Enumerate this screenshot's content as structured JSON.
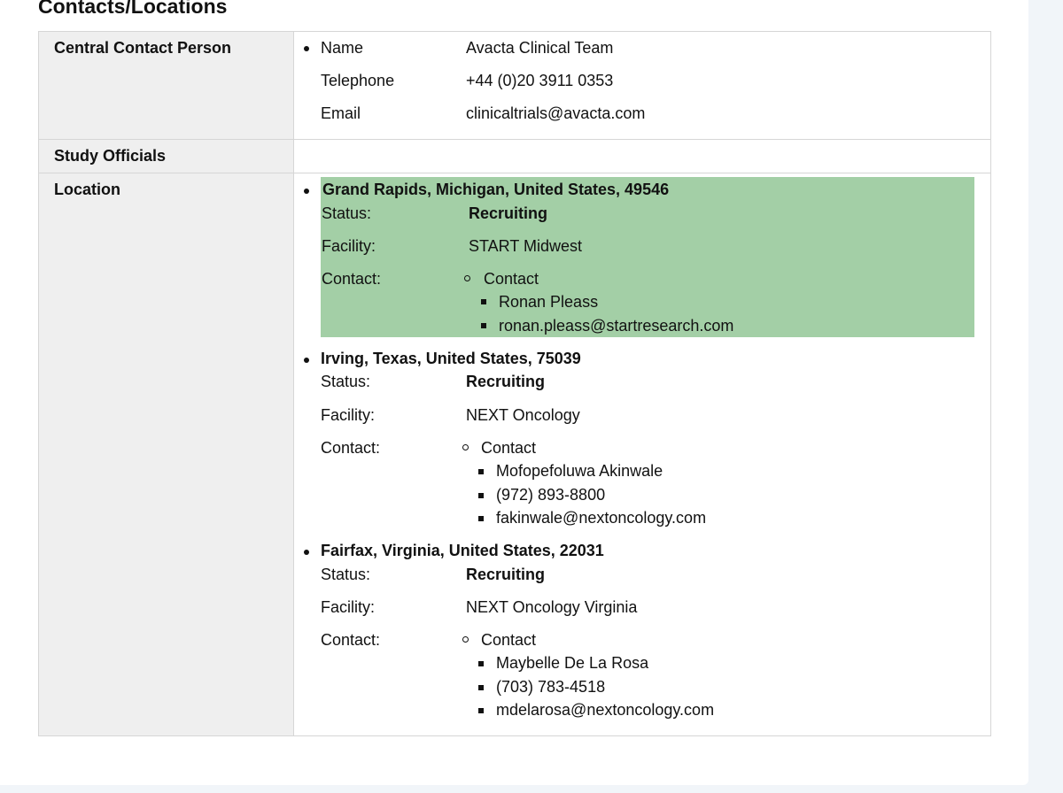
{
  "section_title": "Contacts/Locations",
  "central_contact": {
    "label": "Central Contact Person",
    "fields": [
      {
        "key": "Name",
        "value": "Avacta Clinical Team"
      },
      {
        "key": "Telephone",
        "value": "+44 (0)20 3911 0353"
      },
      {
        "key": "Email",
        "value": "clinicaltrials@avacta.com"
      }
    ]
  },
  "study_officials": {
    "label": "Study Officials"
  },
  "location": {
    "label": "Location",
    "status_key": "Status:",
    "facility_key": "Facility:",
    "contact_key": "Contact:",
    "contact_header": "Contact",
    "sites": [
      {
        "place": "Grand Rapids, Michigan, United States, 49546",
        "status": "Recruiting",
        "facility": "START Midwest",
        "contact_items": [
          "Ronan Pleass",
          "ronan.pleass@startresearch.com"
        ],
        "highlighted": true
      },
      {
        "place": "Irving, Texas, United States, 75039",
        "status": "Recruiting",
        "facility": "NEXT Oncology",
        "contact_items": [
          "Mofopefoluwa Akinwale",
          "(972) 893-8800",
          "fakinwale@nextoncology.com"
        ],
        "highlighted": false
      },
      {
        "place": "Fairfax, Virginia, United States, 22031",
        "status": "Recruiting",
        "facility": "NEXT Oncology Virginia",
        "contact_items": [
          "Maybelle De La Rosa",
          "(703) 783-4518",
          "mdelarosa@nextoncology.com"
        ],
        "highlighted": false
      }
    ]
  },
  "colors": {
    "highlight": "#a3cfa6",
    "label_bg": "#efefef",
    "border": "#d6d6d6",
    "page_bg": "#f1f5f9"
  }
}
